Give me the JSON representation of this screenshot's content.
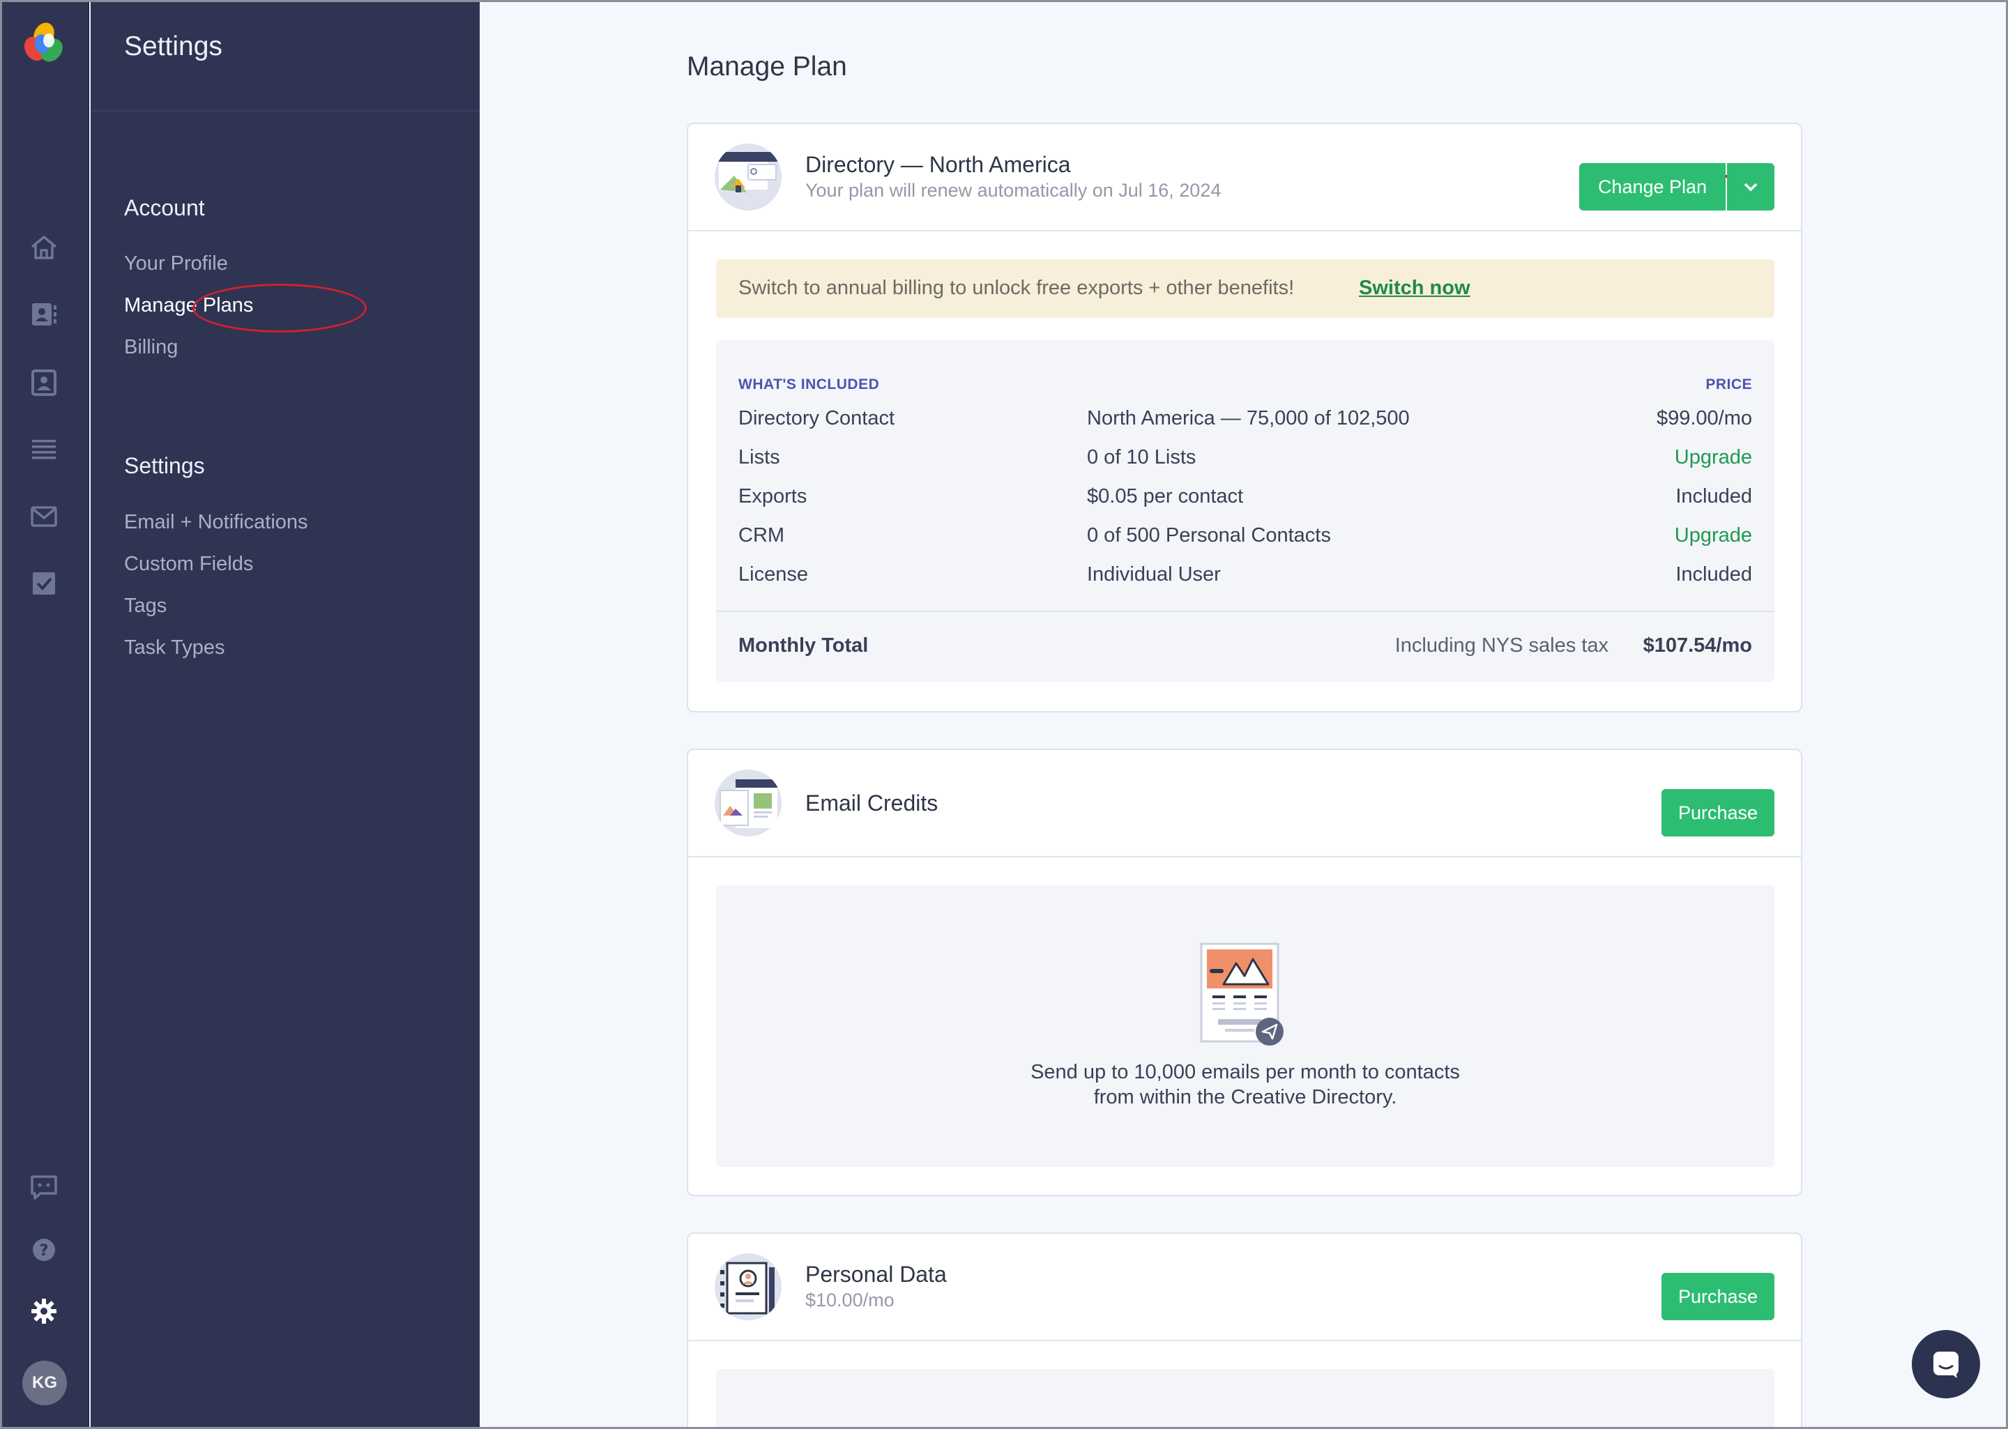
{
  "app": {
    "section_title": "Settings"
  },
  "user": {
    "initials": "KG"
  },
  "sidebar": {
    "groups": [
      {
        "heading": "Account",
        "items": [
          "Your Profile",
          "Manage Plans",
          "Billing"
        ]
      },
      {
        "heading": "Settings",
        "items": [
          "Email + Notifications",
          "Custom Fields",
          "Tags",
          "Task Types"
        ]
      }
    ],
    "active_item": "Manage Plans"
  },
  "rail": {
    "icons": [
      "home-icon",
      "contacts-icon",
      "profile-card-icon",
      "list-icon",
      "mail-icon",
      "task-check-icon",
      "feedback-icon",
      "help-icon",
      "gear-icon"
    ]
  },
  "main": {
    "page_title": "Manage Plan",
    "plan_card": {
      "title": "Directory — North America",
      "subtitle": "Your plan will renew automatically on Jul 16, 2024",
      "change_plan_label": "Change Plan",
      "banner_text": "Switch to annual billing to unlock free exports + other benefits!",
      "banner_link": "Switch now",
      "table": {
        "col_included": "WHAT'S INCLUDED",
        "col_price": "PRICE",
        "rows": [
          {
            "item": "Directory Contact",
            "detail": "North America — 75,000 of 102,500",
            "price": "$99.00/mo"
          },
          {
            "item": "Lists",
            "detail": "0 of 10 Lists",
            "price": "Upgrade"
          },
          {
            "item": "Exports",
            "detail": "$0.05 per contact",
            "price": "Included"
          },
          {
            "item": "CRM",
            "detail": "0 of 500 Personal Contacts",
            "price": "Upgrade"
          },
          {
            "item": "License",
            "detail": "Individual User",
            "price": "Included"
          }
        ],
        "total_label": "Monthly Total",
        "total_note": "Including NYS sales tax",
        "total_value": "$107.54/mo"
      }
    },
    "email_card": {
      "title": "Email Credits",
      "purchase_label": "Purchase",
      "description_line1": "Send up to 10,000 emails per month to contacts",
      "description_line2": "from within the Creative Directory."
    },
    "personal_card": {
      "title": "Personal Data",
      "subtitle": "$10.00/mo",
      "purchase_label": "Purchase"
    }
  },
  "colors": {
    "sidebar_bg": "#2f3453",
    "accent_green": "#2dbd72",
    "upgrade_green": "#1f9a50",
    "banner_bg": "#f7efd9",
    "header_label_blue": "#4a55b0",
    "annotation_red": "#d41f2e"
  }
}
